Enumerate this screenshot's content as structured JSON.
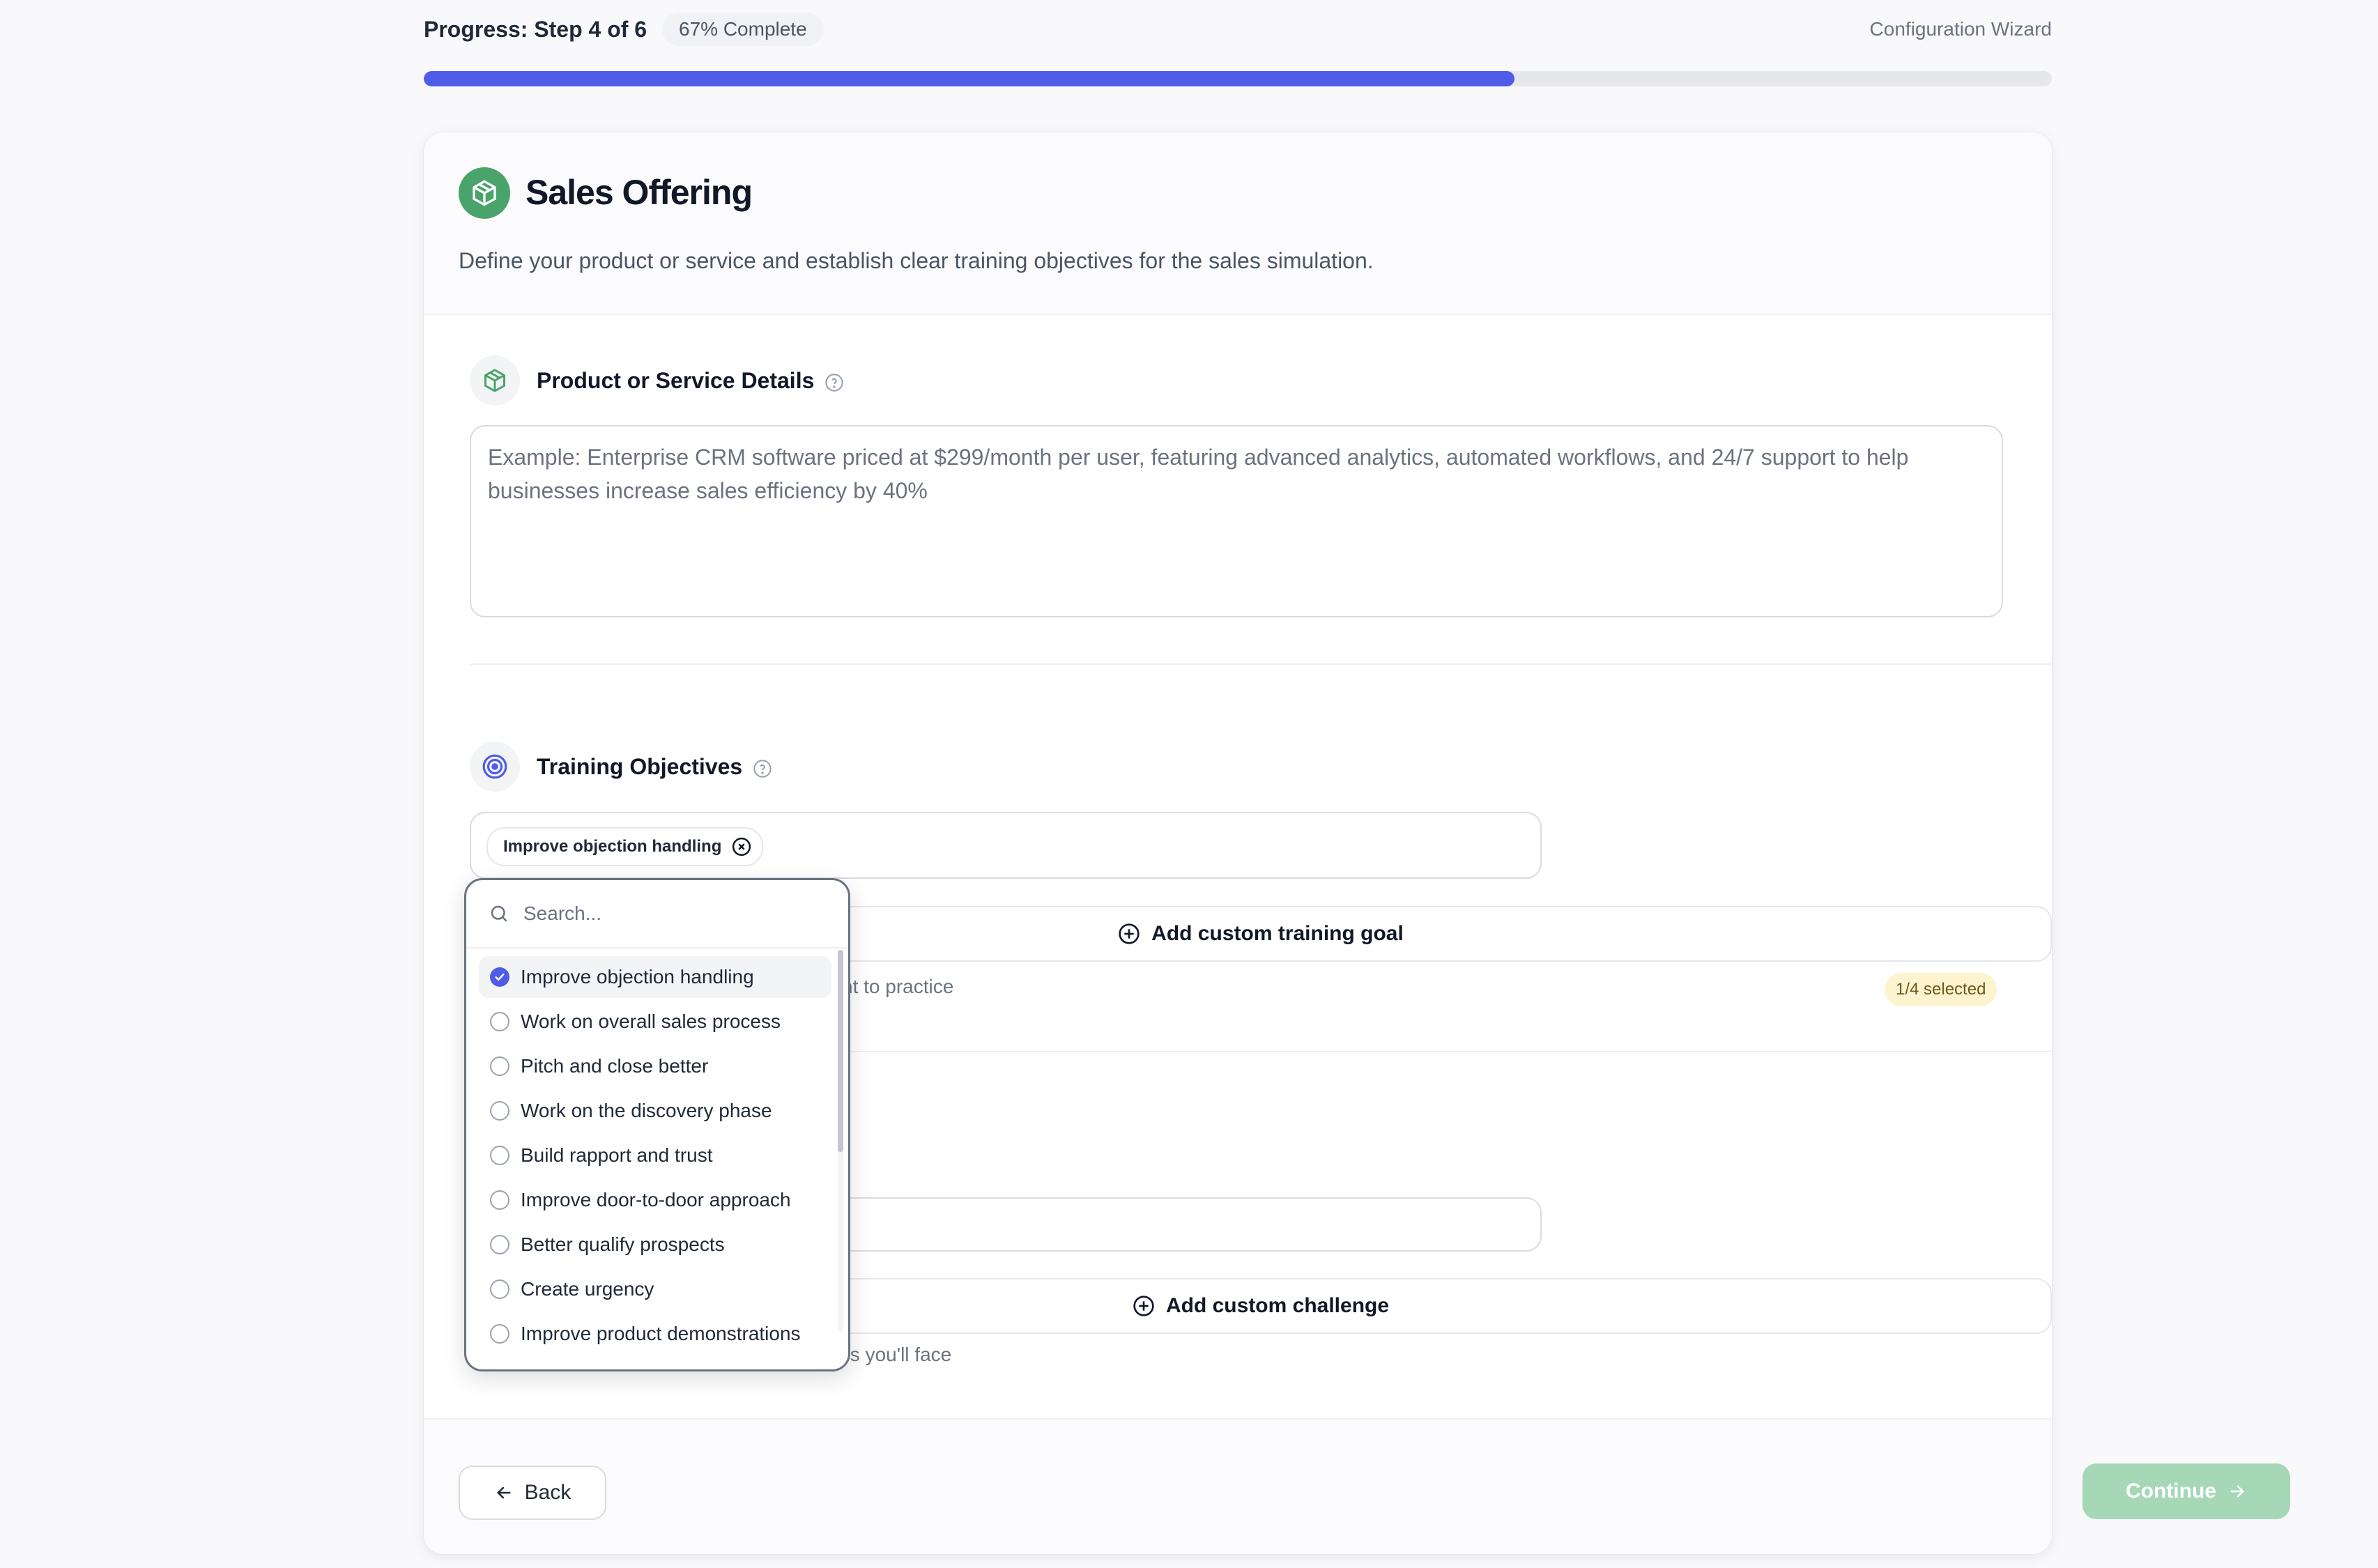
{
  "progress": {
    "title": "Progress: Step 4 of 6",
    "percent_label": "67% Complete",
    "wizard_label": "Configuration Wizard",
    "fraction": 0.67,
    "fill_color": "#4f5ce8"
  },
  "card": {
    "title": "Sales Offering",
    "description": "Define your product or service and establish clear training objectives for the sales simulation.",
    "icon": "package-icon",
    "icon_bg": "#4aa36a"
  },
  "product_section": {
    "title": "Product or Service Details",
    "placeholder": "Example: Enterprise CRM software priced at $299/month per user, featuring advanced analytics, automated workflows, and 24/7 support to help businesses increase sales efficiency by 40%"
  },
  "objectives_section": {
    "title": "Training Objectives",
    "selected_chip": "Improve objection handling",
    "add_button": "Add custom training goal",
    "hint_visible": "nt to practice",
    "selected_count": "1/4 selected"
  },
  "challenges_section": {
    "add_button": "Add custom challenge",
    "hint_visible": "les you'll face"
  },
  "dropdown": {
    "search_placeholder": "Search...",
    "options": [
      {
        "label": "Improve objection handling",
        "selected": true
      },
      {
        "label": "Work on overall sales process",
        "selected": false
      },
      {
        "label": "Pitch and close better",
        "selected": false
      },
      {
        "label": "Work on the discovery phase",
        "selected": false
      },
      {
        "label": "Build rapport and trust",
        "selected": false
      },
      {
        "label": "Improve door-to-door approach",
        "selected": false
      },
      {
        "label": "Better qualify prospects",
        "selected": false
      },
      {
        "label": "Create urgency",
        "selected": false
      },
      {
        "label": "Improve product demonstrations",
        "selected": false
      }
    ]
  },
  "footer": {
    "back_label": "Back",
    "continue_label": "Continue"
  }
}
